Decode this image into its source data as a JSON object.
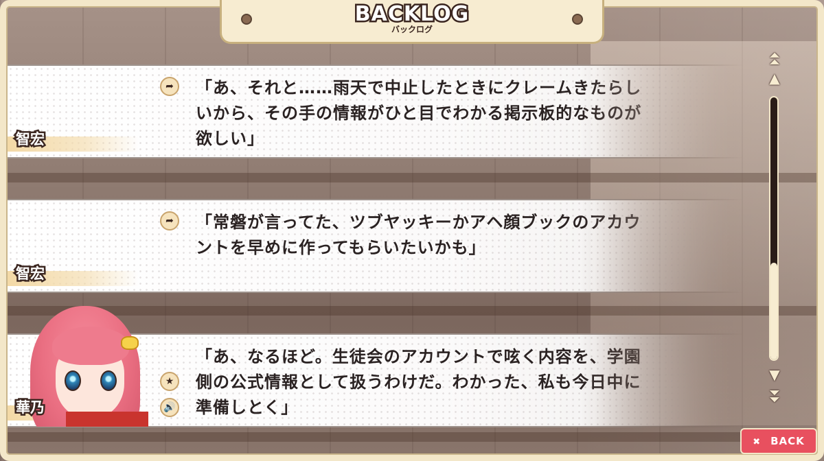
{
  "header": {
    "title": "BACKLOG",
    "subtitle": "バックログ"
  },
  "entries": [
    {
      "speaker": "智宏",
      "text": "「あ、それと……雨天で中止したときにクレームきたらしいから、その手の情報がひと目でわかる掲示板的なものが欲しい」",
      "has_portrait": false
    },
    {
      "speaker": "智宏",
      "text": "「常磐が言ってた、ツブヤッキーかアヘ顔ブックのアカウントを早めに作ってもらいたいかも」",
      "has_portrait": false
    },
    {
      "speaker": "華乃",
      "text": "「あ、なるほど。生徒会のアカウントで呟く内容を、学園側の公式情報として扱うわけだ。わかった、私も今日中に準備しとく」",
      "has_portrait": true
    }
  ],
  "icons": {
    "jump": "arrow-jump-icon",
    "star": "star-icon",
    "voice": "speaker-icon"
  },
  "scrollbar": {
    "thumb_fraction": 0.37,
    "thumb_position": "bottom"
  },
  "back_button": {
    "icon": "✖",
    "label": "BACK"
  },
  "colors": {
    "frame": "#f3e7c9",
    "back_button": "#e8505f",
    "hair": "#ea6f82"
  }
}
